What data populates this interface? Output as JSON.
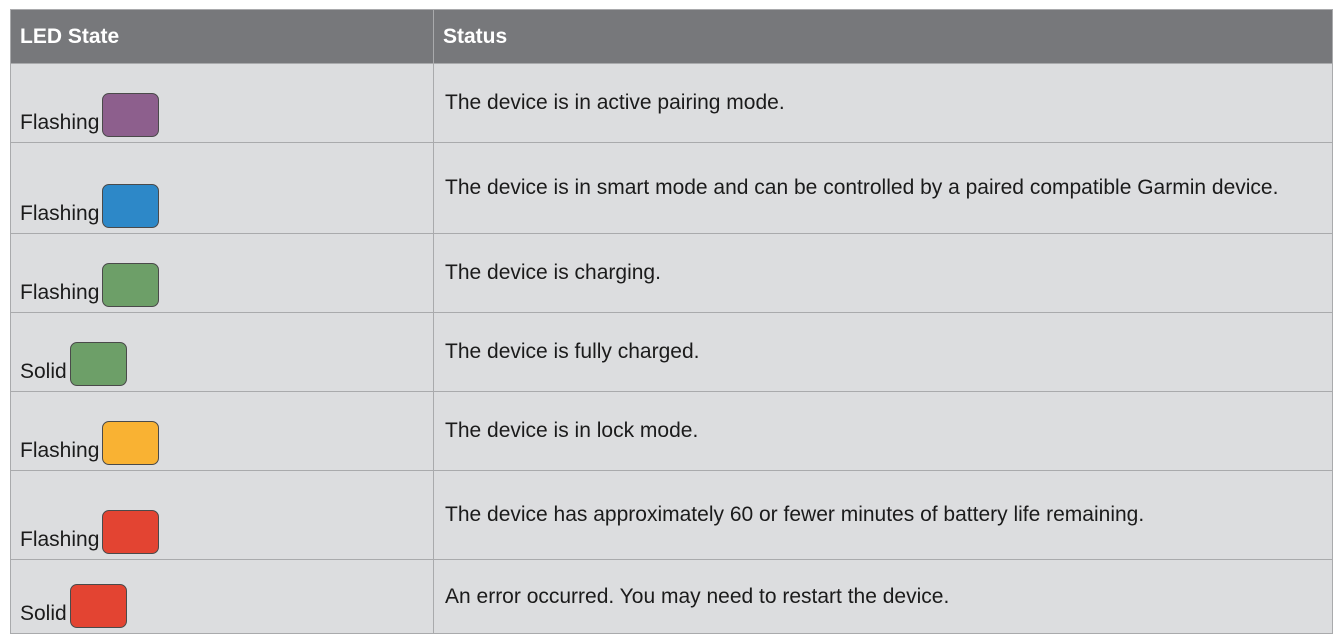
{
  "table": {
    "headers": {
      "led_state": "LED State",
      "status": "Status"
    },
    "rows": [
      {
        "state": "Flashing",
        "color_name": "purple",
        "color": "#8d5f8d",
        "status": "The device is in active pairing mode."
      },
      {
        "state": "Flashing",
        "color_name": "blue",
        "color": "#2d88c8",
        "status": "The device is in smart mode and can be controlled by a paired compatible Garmin device."
      },
      {
        "state": "Flashing",
        "color_name": "green",
        "color": "#6d9f68",
        "status": "The device is charging."
      },
      {
        "state": "Solid",
        "color_name": "green",
        "color": "#6d9f68",
        "status": "The device is fully charged."
      },
      {
        "state": "Flashing",
        "color_name": "yellow",
        "color": "#f9b233",
        "status": "The device is in lock mode."
      },
      {
        "state": "Flashing",
        "color_name": "red",
        "color": "#e34432",
        "status": "The device has approximately 60 or fewer minutes of battery life remaining."
      },
      {
        "state": "Solid",
        "color_name": "red",
        "color": "#e34432",
        "status": "An error occurred. You may need to restart the device."
      }
    ]
  }
}
